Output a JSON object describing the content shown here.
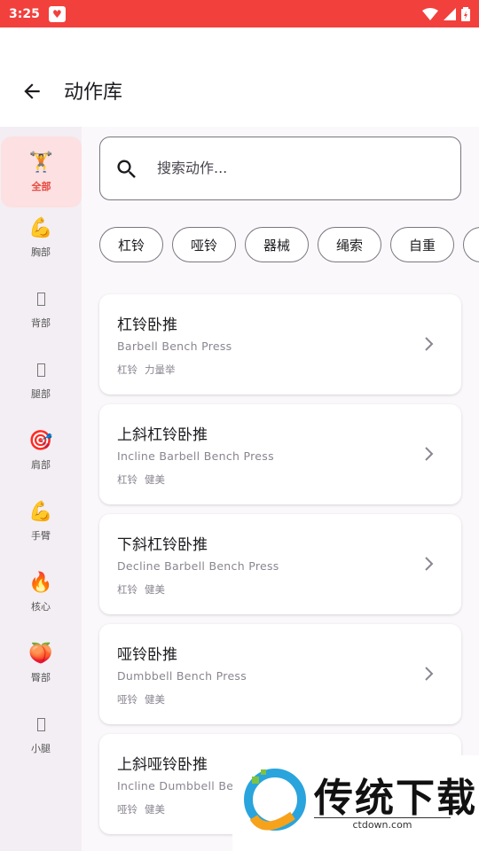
{
  "status_bar": {
    "time": "3:25"
  },
  "header": {
    "title": "动作库"
  },
  "sidebar": {
    "items": [
      {
        "label": "全部",
        "icon": "🏋"
      },
      {
        "label": "胸部",
        "icon": "💪"
      },
      {
        "label": "背部",
        "icon": ""
      },
      {
        "label": "腿部",
        "icon": ""
      },
      {
        "label": "肩部",
        "icon": "🎯"
      },
      {
        "label": "手臂",
        "icon": "💪"
      },
      {
        "label": "核心",
        "icon": "🔥"
      },
      {
        "label": "臀部",
        "icon": "🍑"
      },
      {
        "label": "小腿",
        "icon": ""
      }
    ]
  },
  "search": {
    "placeholder": "搜索动作..."
  },
  "filters": [
    "杠铃",
    "哑铃",
    "器械",
    "绳索",
    "自重"
  ],
  "exercises": [
    {
      "name": "杠铃卧推",
      "english": "Barbell Bench Press",
      "tags": [
        "杠铃",
        "力量举"
      ]
    },
    {
      "name": "上斜杠铃卧推",
      "english": "Incline Barbell Bench Press",
      "tags": [
        "杠铃",
        "健美"
      ]
    },
    {
      "name": "下斜杠铃卧推",
      "english": "Decline Barbell Bench Press",
      "tags": [
        "杠铃",
        "健美"
      ]
    },
    {
      "name": "哑铃卧推",
      "english": "Dumbbell Bench Press",
      "tags": [
        "哑铃",
        "健美"
      ]
    },
    {
      "name": "上斜哑铃卧推",
      "english": "Incline Dumbbell Ben",
      "tags": [
        "哑铃",
        "健美"
      ]
    }
  ],
  "watermark": {
    "text": "传统下载",
    "url": "ctdown.com"
  },
  "colors": {
    "status_bar": "#f2403d",
    "accent": "#e54b41",
    "active_bg": "#fde0e1",
    "sidebar_bg": "#f3eef3"
  }
}
